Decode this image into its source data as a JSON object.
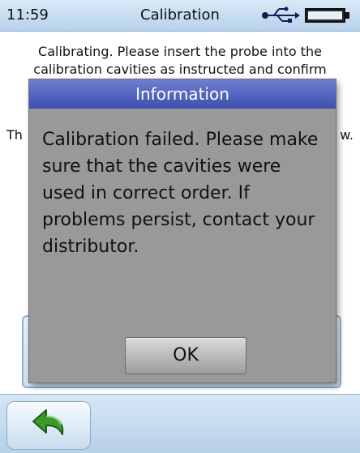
{
  "status_bar": {
    "time": "11:59",
    "title": "Calibration",
    "usb_icon": "usb-icon",
    "battery_icon": "battery-icon"
  },
  "screen": {
    "instruction_line1": "Calibrating. Please insert the probe into the",
    "instruction_line2": "calibration cavities as instructed and confirm",
    "partial_left": "Th",
    "partial_right": "w."
  },
  "dialog": {
    "title": "Information",
    "message": "Calibration failed. Please make sure that the cavities were used in correct order. If problems persist, contact your distributor.",
    "ok_label": "OK"
  },
  "toolbar": {
    "back_icon": "back-arrow-icon"
  },
  "colors": {
    "dialog_header": "#3b4fb0",
    "dialog_body": "#999999",
    "back_arrow": "#3a9a2a"
  }
}
